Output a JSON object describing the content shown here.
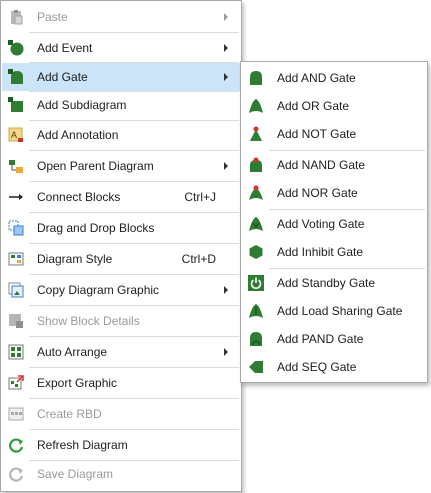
{
  "main_menu": {
    "items": [
      {
        "label": "Paste",
        "shortcut": "",
        "submenu": true,
        "disabled": true,
        "icon": "paste-icon"
      },
      {
        "label": "Add Event",
        "shortcut": "",
        "submenu": true,
        "disabled": false,
        "icon": "event-icon"
      },
      {
        "label": "Add Gate",
        "shortcut": "",
        "submenu": true,
        "disabled": false,
        "icon": "gate-icon"
      },
      {
        "label": "Add Subdiagram",
        "shortcut": "",
        "submenu": false,
        "disabled": false,
        "icon": "subdiagram-icon"
      },
      {
        "label": "Add Annotation",
        "shortcut": "",
        "submenu": false,
        "disabled": false,
        "icon": "annotation-icon"
      },
      {
        "label": "Open Parent Diagram",
        "shortcut": "",
        "submenu": true,
        "disabled": false,
        "icon": "parent-diagram-icon"
      },
      {
        "label": "Connect Blocks",
        "shortcut": "Ctrl+J",
        "submenu": false,
        "disabled": false,
        "icon": "connect-arrow-icon"
      },
      {
        "label": "Drag and Drop Blocks",
        "shortcut": "",
        "submenu": false,
        "disabled": false,
        "icon": "drag-drop-icon"
      },
      {
        "label": "Diagram Style",
        "shortcut": "Ctrl+D",
        "submenu": false,
        "disabled": false,
        "icon": "diagram-style-icon"
      },
      {
        "label": "Copy Diagram Graphic",
        "shortcut": "",
        "submenu": true,
        "disabled": false,
        "icon": "copy-graphic-icon"
      },
      {
        "label": "Show Block Details",
        "shortcut": "",
        "submenu": false,
        "disabled": true,
        "icon": "block-details-icon"
      },
      {
        "label": "Auto Arrange",
        "shortcut": "",
        "submenu": true,
        "disabled": false,
        "icon": "auto-arrange-icon"
      },
      {
        "label": "Export Graphic",
        "shortcut": "",
        "submenu": false,
        "disabled": false,
        "icon": "export-graphic-icon"
      },
      {
        "label": "Create RBD",
        "shortcut": "",
        "submenu": false,
        "disabled": true,
        "icon": "create-rbd-icon"
      },
      {
        "label": "Refresh Diagram",
        "shortcut": "",
        "submenu": false,
        "disabled": false,
        "icon": "refresh-icon"
      },
      {
        "label": "Save Diagram",
        "shortcut": "",
        "submenu": false,
        "disabled": true,
        "icon": "save-icon"
      }
    ]
  },
  "gate_submenu": {
    "items": [
      {
        "label": "Add AND Gate",
        "icon": "and-gate-icon"
      },
      {
        "label": "Add OR Gate",
        "icon": "or-gate-icon"
      },
      {
        "label": "Add NOT Gate",
        "icon": "not-gate-icon"
      },
      {
        "label": "Add NAND Gate",
        "icon": "nand-gate-icon"
      },
      {
        "label": "Add NOR Gate",
        "icon": "nor-gate-icon"
      },
      {
        "label": "Add Voting Gate",
        "icon": "voting-gate-icon"
      },
      {
        "label": "Add Inhibit Gate",
        "icon": "inhibit-gate-icon"
      },
      {
        "label": "Add Standby Gate",
        "icon": "standby-gate-icon"
      },
      {
        "label": "Add Load Sharing Gate",
        "icon": "load-sharing-gate-icon"
      },
      {
        "label": "Add PAND Gate",
        "icon": "pand-gate-icon"
      },
      {
        "label": "Add SEQ Gate",
        "icon": "seq-gate-icon"
      }
    ]
  },
  "colors": {
    "gate_green": "#2e7d32",
    "highlight": "#cce4f7",
    "nand_red": "#d32f2f"
  }
}
